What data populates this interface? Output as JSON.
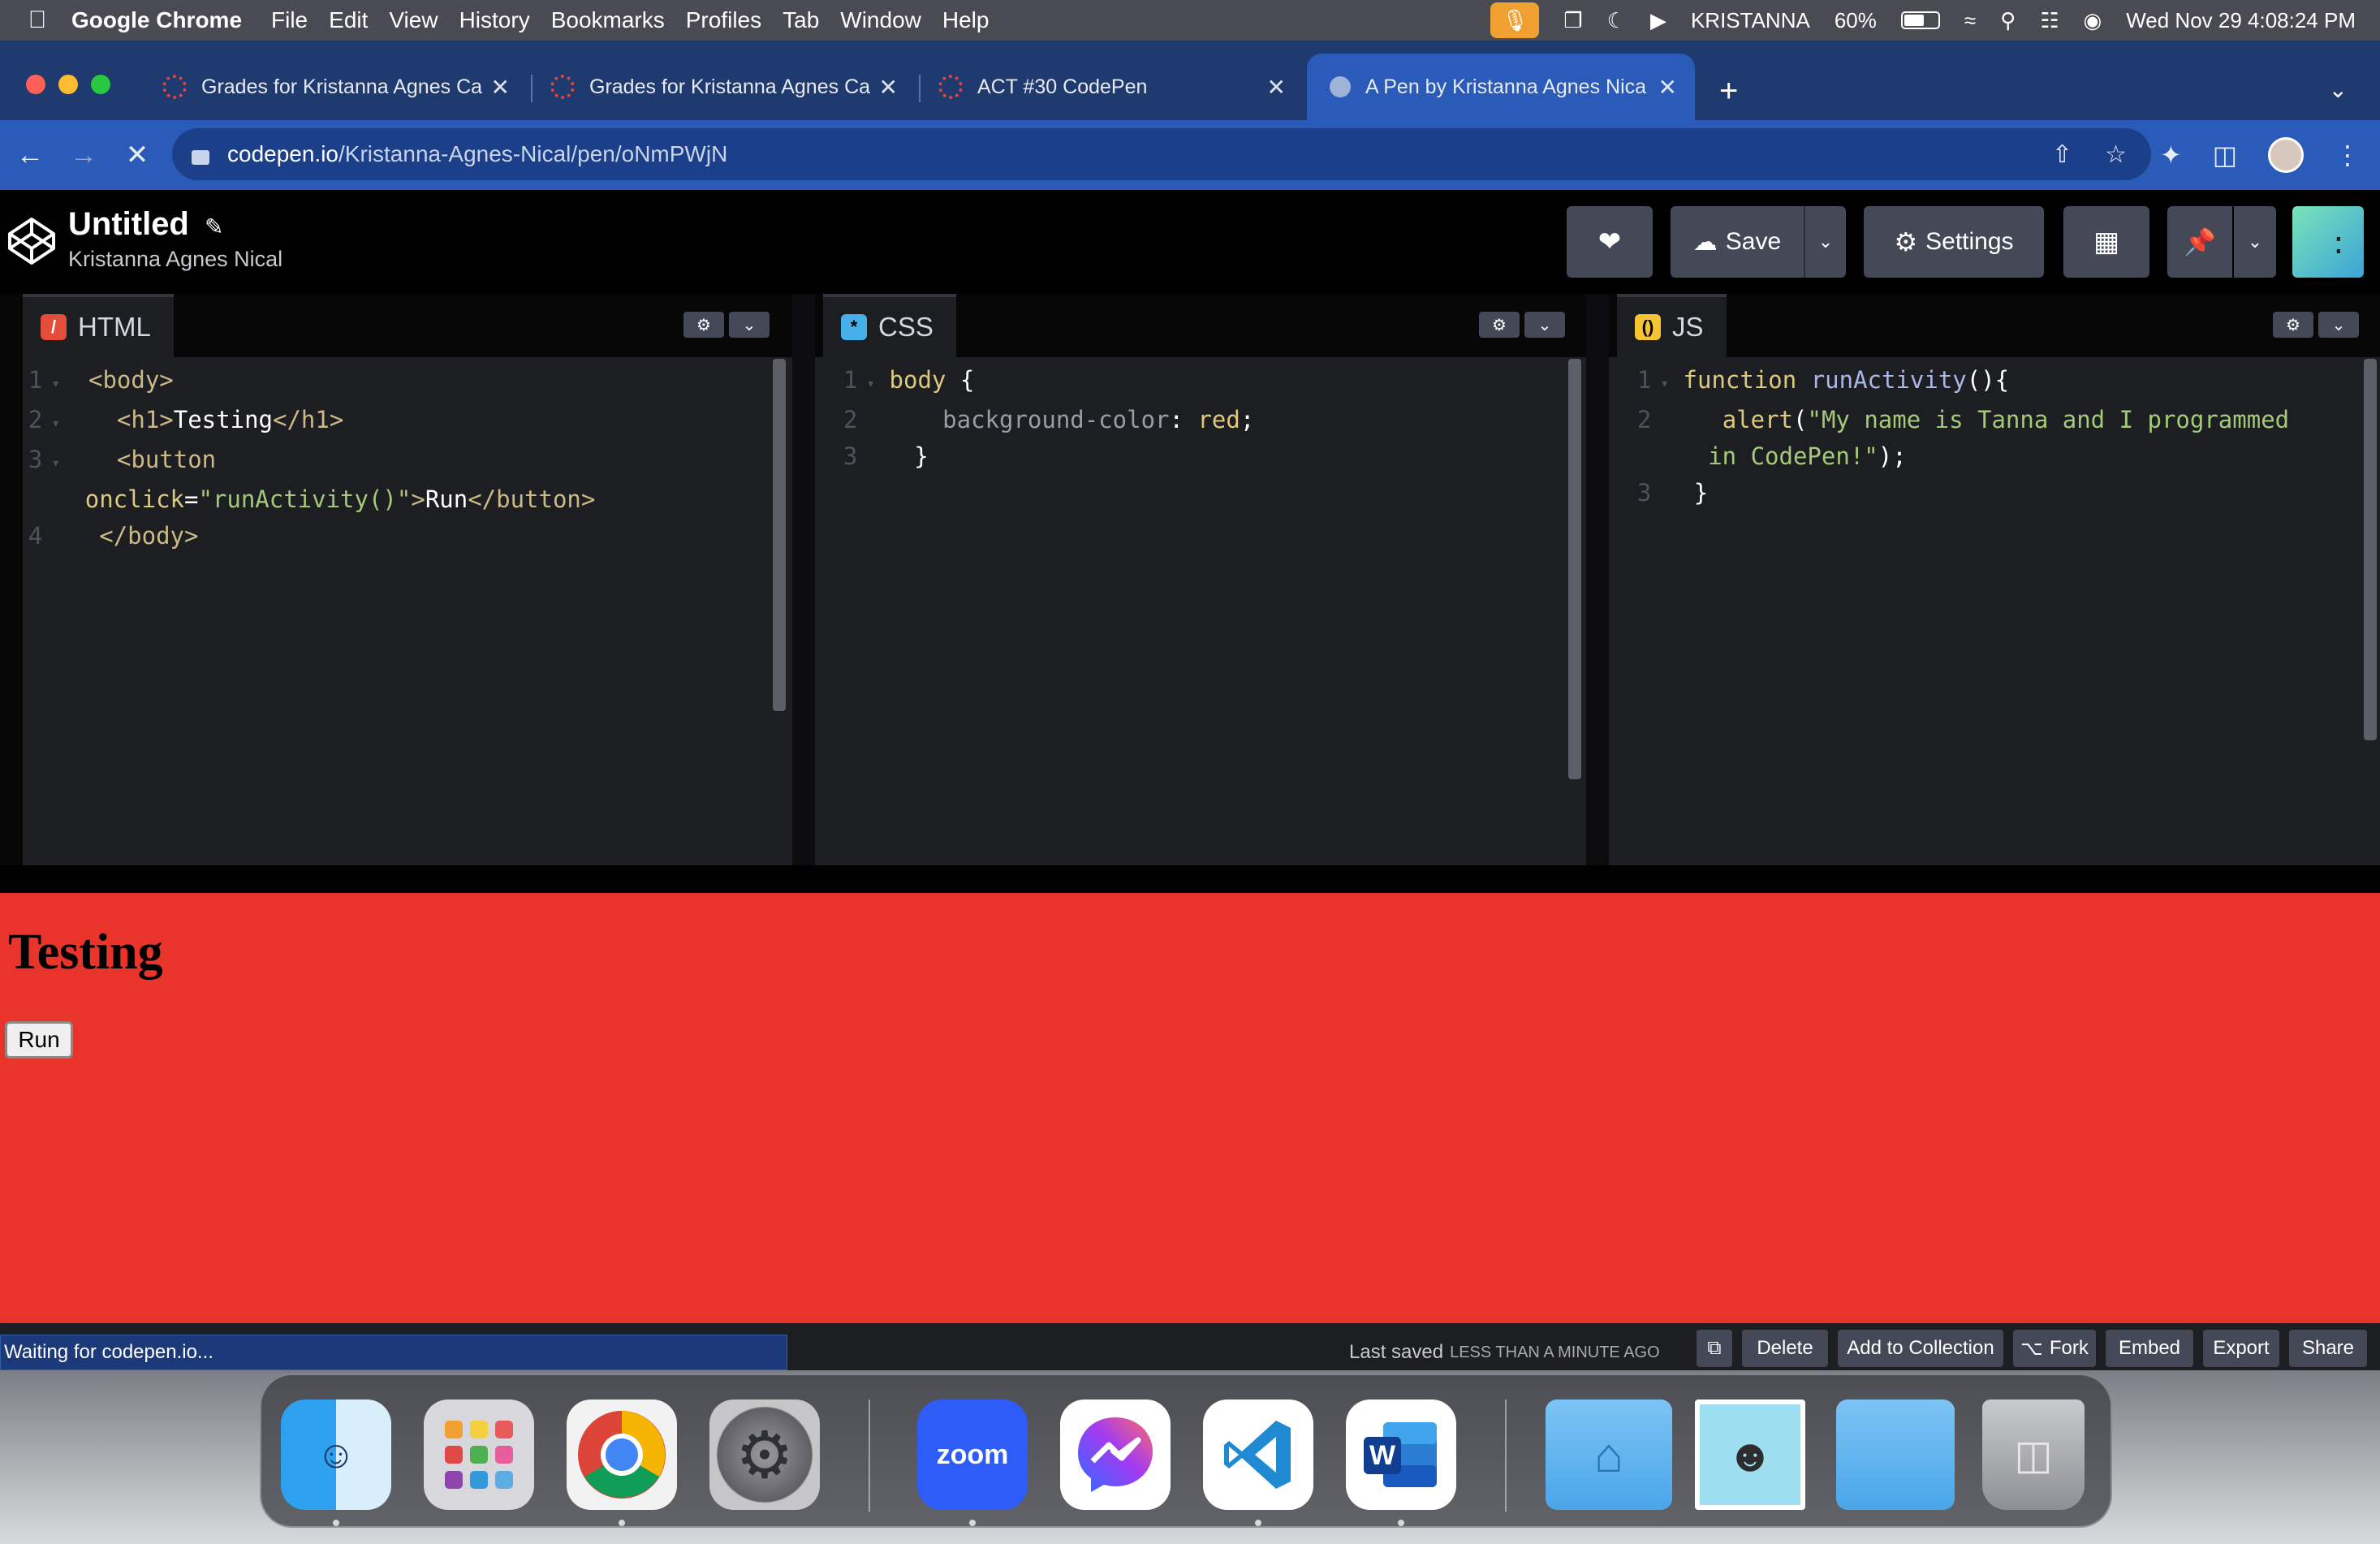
{
  "menubar": {
    "app": "Google Chrome",
    "items": [
      "File",
      "Edit",
      "View",
      "History",
      "Bookmarks",
      "Profiles",
      "Tab",
      "Window",
      "Help"
    ],
    "user": "KRISTANNA",
    "battery": "60%",
    "datetime": "Wed Nov 29  4:08:24 PM"
  },
  "browser": {
    "tabs": [
      {
        "title": "Grades for Kristanna Agnes Ca"
      },
      {
        "title": "Grades for Kristanna Agnes Ca"
      },
      {
        "title": "ACT #30 CodePen"
      },
      {
        "title": "A Pen by Kristanna Agnes Nica"
      }
    ],
    "url_host": "codepen.io",
    "url_path": "/Kristanna-Agnes-Nical/pen/oNmPWjN"
  },
  "codepen": {
    "title": "Untitled",
    "author": "Kristanna Agnes Nical",
    "save_label": "Save",
    "settings_label": "Settings",
    "panes": {
      "html": {
        "label": "HTML"
      },
      "css": {
        "label": "CSS"
      },
      "js": {
        "label": "JS"
      }
    },
    "line_numbers": [
      "1",
      "2",
      "3",
      "4"
    ]
  },
  "preview": {
    "heading": "Testing",
    "button": "Run"
  },
  "footer": {
    "status": "Waiting for codepen.io...",
    "last_saved": "Last saved",
    "last_saved_ago": "LESS THAN A MINUTE AGO",
    "buttons": [
      "Delete",
      "Add to Collection",
      "Fork",
      "Embed",
      "Export",
      "Share"
    ]
  },
  "dock": {
    "zoom_label": "zoom"
  },
  "colors": {
    "preview_bg": "#e8342a",
    "chrome_tab": "#2a5bb8",
    "editor_bg": "#1d1e22"
  }
}
